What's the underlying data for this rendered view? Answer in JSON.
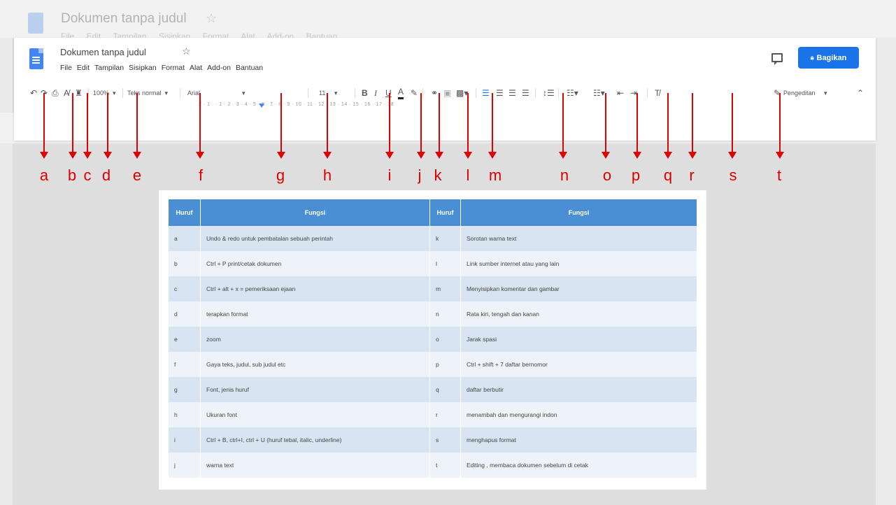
{
  "ghost": {
    "title": "Dokumen tanpa judul",
    "menu": "File Edit Tampilan Sisipkan Format Alat Add-on Bantuan"
  },
  "window": {
    "title": "Dokumen tanpa judul",
    "menu": [
      "File",
      "Edit",
      "Tampilan",
      "Sisipkan",
      "Format",
      "Alat",
      "Add-on",
      "Bantuan"
    ],
    "share_label": "Bagikan",
    "accent_color": "#1a73e8"
  },
  "toolbar": {
    "zoom": "100%",
    "style": "Teks normal",
    "font": "Arial",
    "size": "11",
    "mode": "Pengeditan",
    "icons": [
      "undo-icon",
      "redo-icon",
      "print-icon",
      "spellcheck-icon",
      "paint-format-icon",
      "bold-icon",
      "italic-icon",
      "underline-icon",
      "text-color-icon",
      "highlight-icon",
      "link-icon",
      "comment-icon",
      "image-icon",
      "align-left-icon",
      "align-center-icon",
      "align-right-icon",
      "justify-icon",
      "line-spacing-icon",
      "numbered-list-icon",
      "bulleted-list-icon",
      "decrease-indent-icon",
      "increase-indent-icon",
      "clear-format-icon",
      "pencil-icon",
      "collapse-icon"
    ]
  },
  "ruler": "2 · 1 · · 1 · 2 · 3 · 4 · 5 · 6 · 7 · 8 · 9 · 10 · 11 · 12 · 13 · 14 · 15 · 16 · 17 · 18",
  "labels": [
    "a",
    "b",
    "c",
    "d",
    "e",
    "f",
    "g",
    "h",
    "i",
    "j",
    "k",
    "l",
    "m",
    "n",
    "o",
    "p",
    "q",
    "r",
    "s",
    "t"
  ],
  "table": {
    "headers": [
      "Huruf",
      "Fungsi",
      "Huruf",
      "Fungsi"
    ],
    "rows": [
      [
        "a",
        "Undo & redo untuk pembatalan sebuah perintah",
        "k",
        "Sorotan warna text"
      ],
      [
        "b",
        "Ctrl + P print/cetak dokumen",
        "l",
        "Link sumber internet atau yang lain"
      ],
      [
        "c",
        "Ctrl + alt + x = pemeriksaan ejaan",
        "m",
        "Menyisipkan komentar dan gambar"
      ],
      [
        "d",
        "terapkan format",
        "n",
        "Rata kiri, tengah dan kanan"
      ],
      [
        "e",
        "zoom",
        "o",
        "Jarak spasi"
      ],
      [
        "f",
        "Gaya teks, judul, sub judul etc",
        "p",
        "Ctrl + shift + 7 daftar bernomor"
      ],
      [
        "g",
        "Font, jenis huruf",
        "q",
        "daftar berbutir"
      ],
      [
        "h",
        "Ukuran font",
        "r",
        "menambah dan mengurangi indon"
      ],
      [
        "i",
        "Ctrl + B, ctrl+I, ctrl + U (huruf tebal, italic, underline)",
        "s",
        "menghapus format"
      ],
      [
        "j",
        "warna text",
        "t",
        "Editing , membaca dokumen sebelum di cetak"
      ]
    ]
  }
}
